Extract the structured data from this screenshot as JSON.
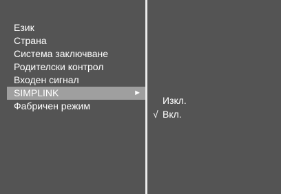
{
  "menu": {
    "items": [
      {
        "label": "Език"
      },
      {
        "label": "Страна"
      },
      {
        "label": "Система заключване"
      },
      {
        "label": "Родителски контрол"
      },
      {
        "label": "Входен сигнал"
      },
      {
        "label": "SIMPLINK",
        "selected": true,
        "arrow": "►"
      },
      {
        "label": "Фабричен режим"
      }
    ]
  },
  "submenu": {
    "options": [
      {
        "label": "Изкл.",
        "checked": false
      },
      {
        "label": "Вкл.",
        "checked": true,
        "check": "√"
      }
    ]
  },
  "colors": {
    "panel_background": "#545454",
    "highlight": "#9f9f9f",
    "divider": "#ececec",
    "text": "#ffffff"
  }
}
